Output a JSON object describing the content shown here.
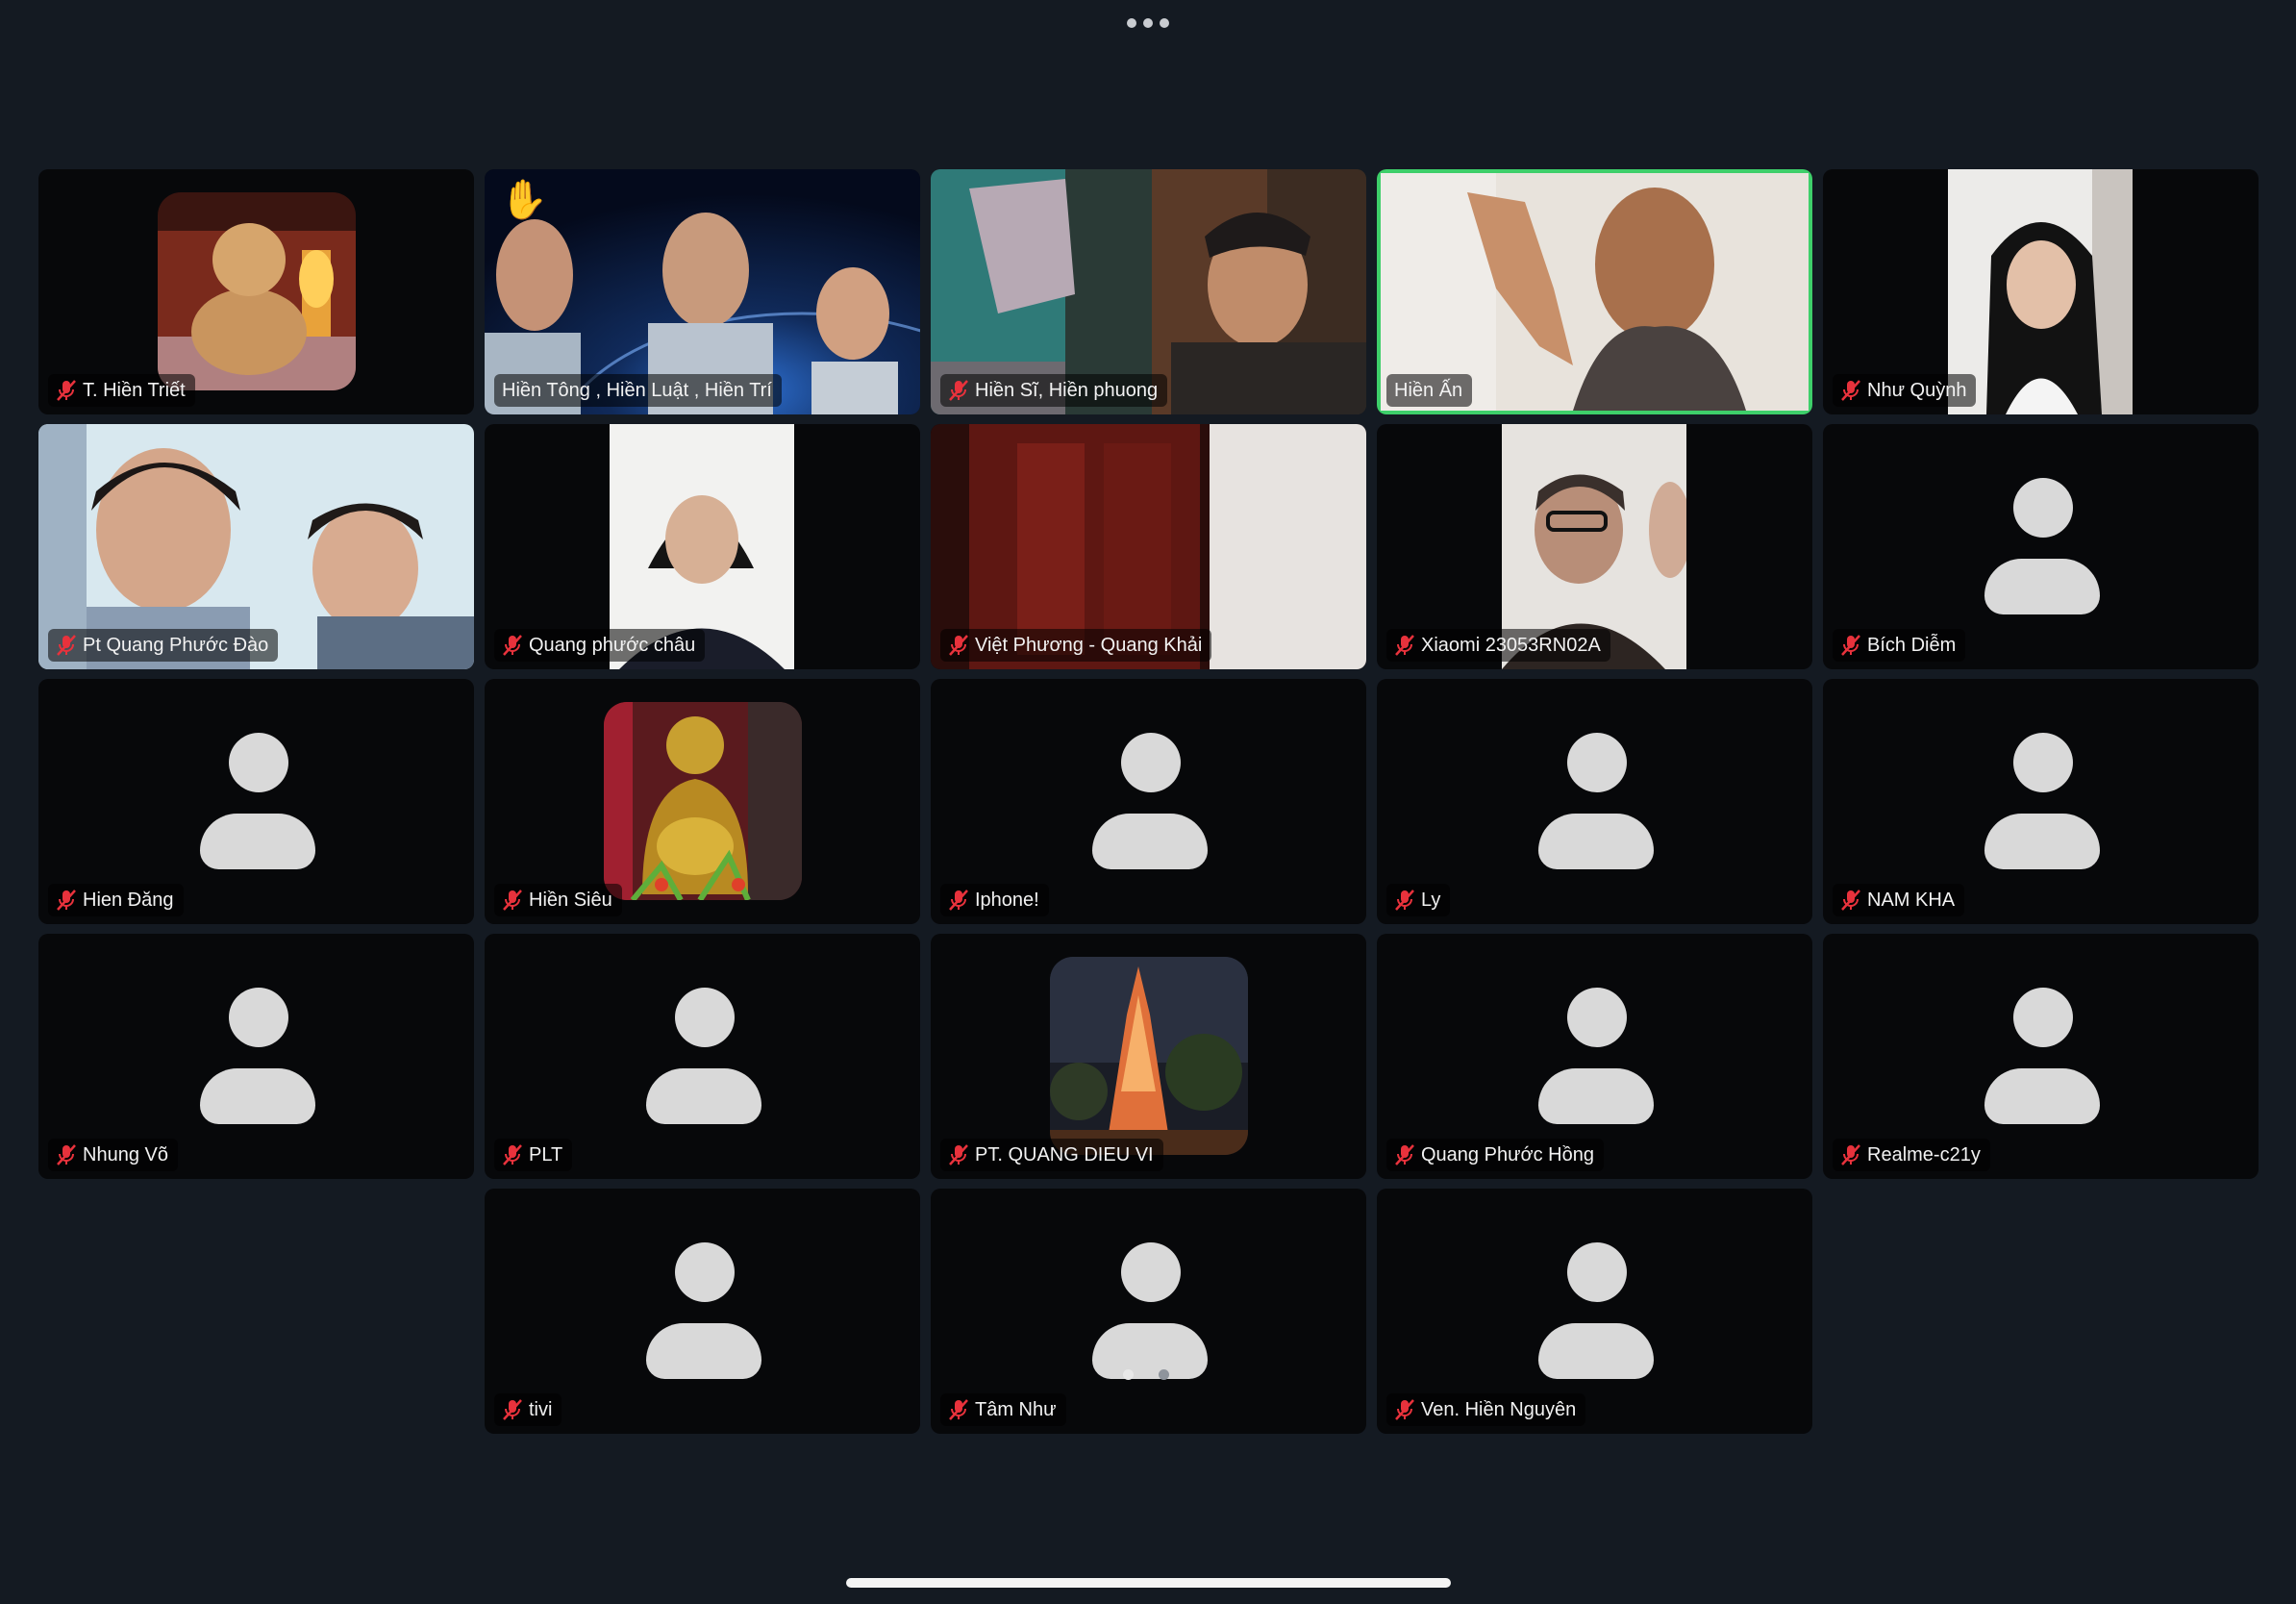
{
  "colors": {
    "background": "#141a22",
    "tile": "#07080a",
    "active_speaker_border": "#3ecf6a",
    "mute_icon": "#e8323c",
    "avatar": "#d9d9d9"
  },
  "top_bar": {
    "icon": "more-dots-icon"
  },
  "participants": [
    {
      "name": "T. Hiền Triết",
      "muted": true,
      "media": "picture"
    },
    {
      "name": "Hiền Tông , Hiền Luật , Hiền Trí",
      "muted": false,
      "media": "video",
      "hand_raised": true
    },
    {
      "name": "Hiền Sĩ, Hiền phuong",
      "muted": true,
      "media": "video"
    },
    {
      "name": "Hiền Ấn",
      "muted": false,
      "media": "video",
      "active_speaker": true
    },
    {
      "name": "Như Quỳnh",
      "muted": true,
      "media": "video"
    },
    {
      "name": "Pt Quang Phước Đào",
      "muted": true,
      "media": "video"
    },
    {
      "name": "Quang phước châu",
      "muted": true,
      "media": "video"
    },
    {
      "name": "Việt Phương - Quang Khải",
      "muted": true,
      "media": "video"
    },
    {
      "name": "Xiaomi 23053RN02A",
      "muted": true,
      "media": "video"
    },
    {
      "name": "Bích Diễm",
      "muted": true,
      "media": "avatar"
    },
    {
      "name": "Hien Đăng",
      "muted": true,
      "media": "avatar"
    },
    {
      "name": "Hiền Siêu",
      "muted": true,
      "media": "picture"
    },
    {
      "name": "Iphone!",
      "muted": true,
      "media": "avatar"
    },
    {
      "name": "Ly",
      "muted": true,
      "media": "avatar"
    },
    {
      "name": "NAM KHA",
      "muted": true,
      "media": "avatar"
    },
    {
      "name": "Nhung Võ",
      "muted": true,
      "media": "avatar"
    },
    {
      "name": "PLT",
      "muted": true,
      "media": "avatar"
    },
    {
      "name": "PT. QUANG DIEU VI",
      "muted": true,
      "media": "picture"
    },
    {
      "name": "Quang Phước Hồng",
      "muted": true,
      "media": "avatar"
    },
    {
      "name": "Realme-c21y",
      "muted": true,
      "media": "avatar"
    },
    {
      "name": "tivi",
      "muted": true,
      "media": "avatar"
    },
    {
      "name": "Tâm Như",
      "muted": true,
      "media": "avatar"
    },
    {
      "name": "Ven. Hiền Nguyên",
      "muted": true,
      "media": "avatar"
    }
  ],
  "pagination": {
    "pages": 2,
    "current": 1
  }
}
